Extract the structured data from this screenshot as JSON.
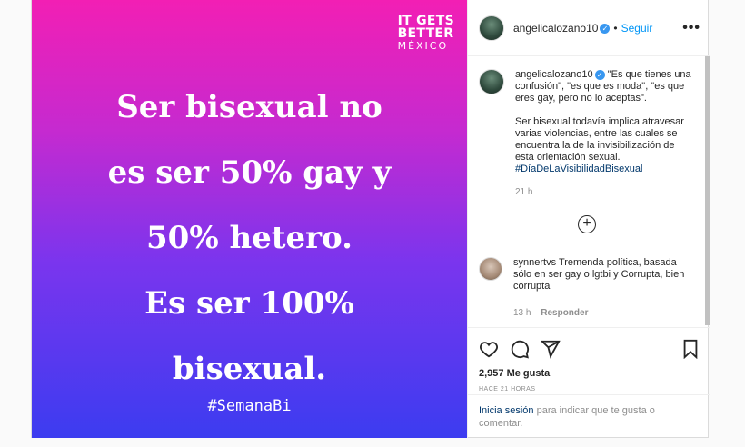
{
  "image": {
    "logo": [
      "IT GETS",
      "BETTER",
      "MÉXICO"
    ],
    "headline": [
      "Ser bisexual no",
      "es ser 50% gay y",
      "50% hetero.",
      "Es ser 100%",
      "bisexual."
    ],
    "hashtag": "#SemanaBi"
  },
  "header": {
    "username": "angelicalozano10",
    "verified_mark": "✓",
    "separator": "•",
    "follow": "Seguir",
    "more": "•••"
  },
  "caption": {
    "username": "angelicalozano10",
    "verified_mark": "✓",
    "text1": "\"Es que tienes una confusión\", \"es que es moda\", \"es que eres gay, pero no lo aceptas\".",
    "text2": "Ser bisexual todavía implica atravesar varias violencias, entre las cuales se encuentra la de la invisibilización de esta orientación sexual. ",
    "hashtag": "#DíaDeLaVisibilidadBisexual",
    "time": "21 h"
  },
  "load_more": "+",
  "comment": {
    "username": "synnertvs",
    "text": "Tremenda política, basada sólo en ser gay o lgtbi y Corrupta, bien corrupta",
    "time": "13 h",
    "reply": "Responder"
  },
  "likes": "2,957 Me gusta",
  "posted_ago": "HACE 21 HORAS",
  "login": {
    "link": "Inicia sesión",
    "text": " para indicar que te gusta o comentar."
  }
}
